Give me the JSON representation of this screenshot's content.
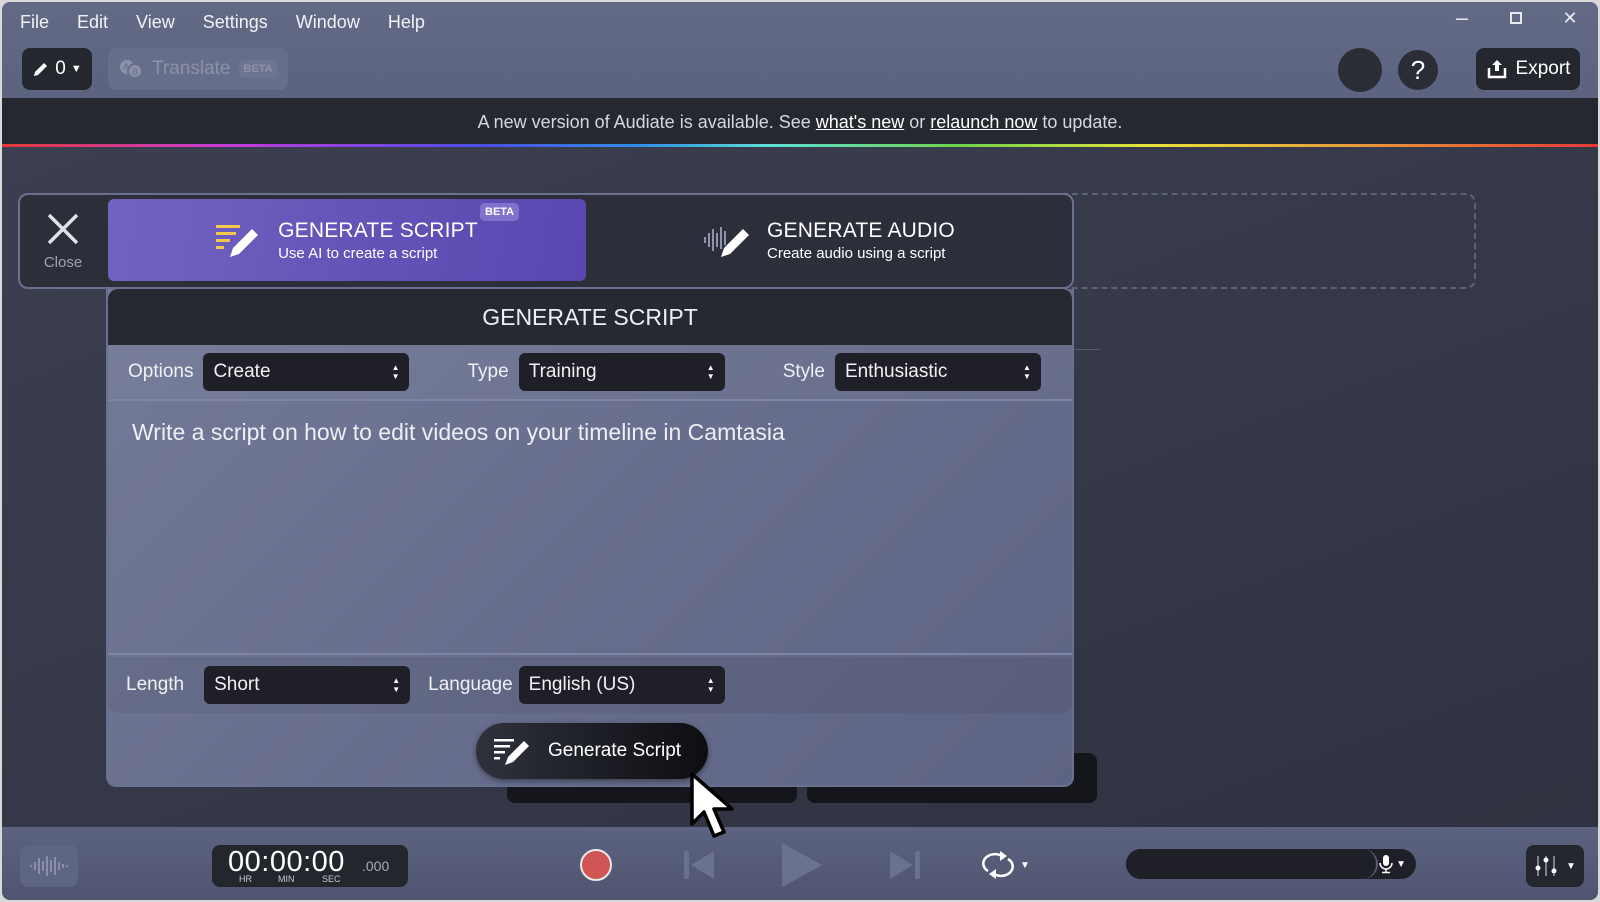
{
  "menubar": {
    "items": [
      {
        "label": "File"
      },
      {
        "label": "Edit"
      },
      {
        "label": "View"
      },
      {
        "label": "Settings"
      },
      {
        "label": "Window"
      },
      {
        "label": "Help"
      }
    ]
  },
  "window_controls": {
    "minimize": "minimize-icon",
    "maximize": "maximize-icon",
    "close": "close-icon"
  },
  "toolbar": {
    "edit_count": "0",
    "translate_label": "Translate",
    "translate_badge": "BETA",
    "help_label": "?",
    "export_label": "Export"
  },
  "banner": {
    "text_before": "A new version of Audiate is available. See",
    "link_whats_new": "what's new",
    "text_middle": "or",
    "link_relaunch": "relaunch now",
    "text_after": "to update."
  },
  "generate": {
    "close_label": "Close",
    "tabs": [
      {
        "title": "GENERATE SCRIPT",
        "subtitle": "Use AI to create a script",
        "badge": "BETA",
        "active": true
      },
      {
        "title": "GENERATE AUDIO",
        "subtitle": "Create audio using a script",
        "active": false
      }
    ],
    "panel_title": "GENERATE SCRIPT",
    "fields": {
      "options": {
        "label": "Options",
        "value": "Create"
      },
      "type": {
        "label": "Type",
        "value": "Training"
      },
      "style": {
        "label": "Style",
        "value": "Enthusiastic"
      },
      "length": {
        "label": "Length",
        "value": "Short"
      },
      "language": {
        "label": "Language",
        "value": "English (US)"
      }
    },
    "prompt": "Write a script on how to edit videos on your timeline in Camtasia",
    "button_label": "Generate Script"
  },
  "transport": {
    "timecode": "00:00:00",
    "milliseconds": ".000",
    "labels": {
      "hr": "HR",
      "min": "MIN",
      "sec": "SEC"
    }
  },
  "colors": {
    "accent_purple": "#6655b8",
    "record_red": "#d15454",
    "banner_bg": "#262830"
  }
}
